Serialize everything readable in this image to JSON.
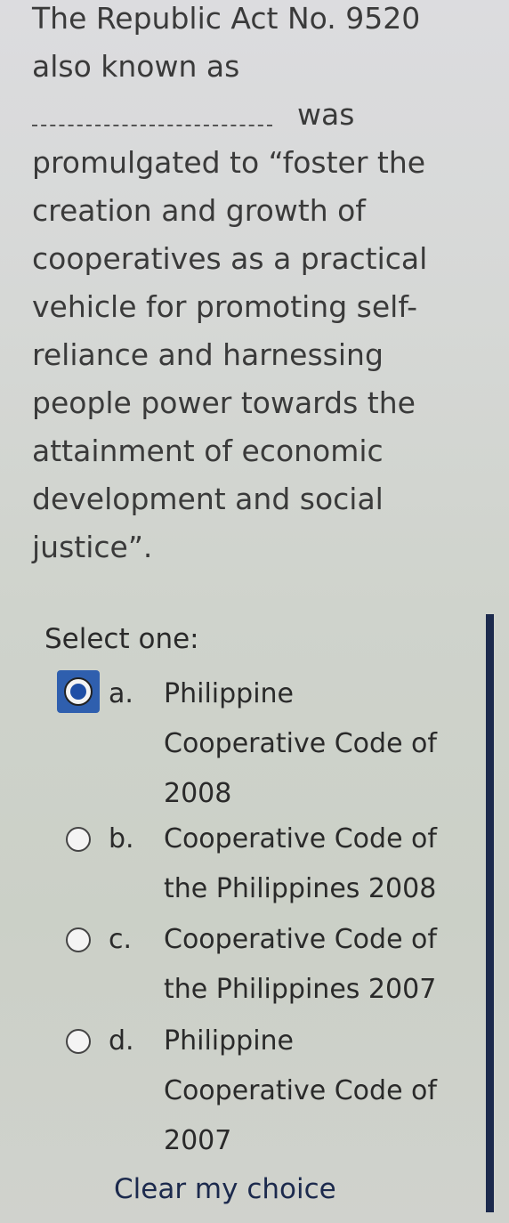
{
  "question": {
    "lines": [
      "The Republic Act No. 9520",
      "also known as",
      "was",
      "promulgated to “foster the",
      "creation and growth of",
      "cooperatives as a practical",
      "vehicle for promoting self-",
      "reliance and harnessing",
      "people power towards the",
      "attainment of economic",
      "development and social",
      "justice”."
    ]
  },
  "select_label": "Select one:",
  "selected_option": "a",
  "options": [
    {
      "letter": "a.",
      "lines": [
        "Philippine",
        "Cooperative Code of",
        "2008"
      ],
      "selected": true
    },
    {
      "letter": "b.",
      "lines": [
        "Cooperative Code of",
        "the Philippines 2008"
      ],
      "selected": false
    },
    {
      "letter": "c.",
      "lines": [
        "Cooperative Code of",
        "the Philippines 2007"
      ],
      "selected": false
    },
    {
      "letter": "d.",
      "lines": [
        "Philippine",
        "Cooperative Code of",
        "2007"
      ],
      "selected": false
    }
  ],
  "clear_label": "Clear my choice",
  "colors": {
    "accent": "#1c2a4d",
    "radio_selected": "#2f5fae"
  }
}
